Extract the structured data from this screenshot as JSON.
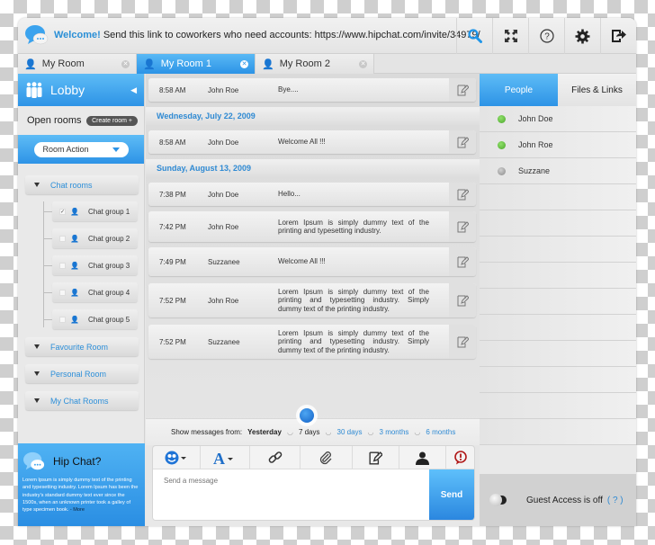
{
  "header": {
    "welcome_bold": "Welcome!",
    "welcome_text": " Send this link to coworkers who need accounts: https://www.hipchat.com/invite/34979/",
    "icons": [
      "search-icon",
      "fullscreen-icon",
      "help-icon",
      "gear-icon",
      "logout-icon"
    ]
  },
  "tabs": [
    {
      "label": "My Room",
      "active": false
    },
    {
      "label": "My Room 1",
      "active": true
    },
    {
      "label": "My Room 2",
      "active": false
    }
  ],
  "sidebar": {
    "lobby_label": "Lobby",
    "open_rooms_label": "Open rooms",
    "create_room_label": "Create room +",
    "room_action_label": "Room Action",
    "sections": {
      "chat_rooms": "Chat rooms",
      "favourite": "Favourite Room",
      "personal": "Personal Room",
      "my_chat_rooms": "My Chat Rooms"
    },
    "chat_groups": [
      {
        "label": "Chat group 1",
        "checked": true
      },
      {
        "label": "Chat group 2",
        "checked": false
      },
      {
        "label": "Chat group 3",
        "checked": false
      },
      {
        "label": "Chat group 4",
        "checked": false
      },
      {
        "label": "Chat group 5",
        "checked": false
      }
    ],
    "promo": {
      "title": "Hip Chat?",
      "text": "Lorem Ipsum is simply dummy text of the printing and typesetting industry. Lorem Ipsum has been the industry's standard dummy text ever since the 1500s, when an unknown printer took a galley of type specimen book. ",
      "more": "- More"
    }
  },
  "chat": {
    "messages": [
      {
        "time": "8:58 AM",
        "user": "John Roe",
        "text": "Bye...."
      },
      {
        "date": "Wednesday, July 22, 2009"
      },
      {
        "time": "8:58 AM",
        "user": "John Doe",
        "text": "Welcome All !!!"
      },
      {
        "date": "Sunday, August 13, 2009"
      },
      {
        "time": "7:38 PM",
        "user": "John Doe",
        "text": "Hello..."
      },
      {
        "time": "7:42 PM",
        "user": "John Roe",
        "text": "Lorem Ipsum is simply dummy text of the printing and typesetting industry."
      },
      {
        "time": "7:49 PM",
        "user": "Suzzanee",
        "text": "Welcome All !!!"
      },
      {
        "time": "7:52 PM",
        "user": "John Roe",
        "text": "Lorem Ipsum is simply dummy text of the printing and typesetting industry. Simply dummy text of the printing industry."
      },
      {
        "time": "7:52 PM",
        "user": "Suzzanee",
        "text": "Lorem Ipsum is simply dummy text of the printing and typesetting industry. Simply dummy text of the printing industry."
      }
    ],
    "filter": {
      "label": "Show messages from:",
      "options": [
        "Yesterday",
        "7 days",
        "30 days",
        "3 months",
        "6 months"
      ],
      "selected": "7 days"
    },
    "composer": {
      "placeholder": "Send a message",
      "send_label": "Send",
      "tools": [
        "emoticon-icon",
        "font-icon",
        "link-icon",
        "attachment-icon",
        "edit-icon",
        "user-icon",
        "alert-icon"
      ]
    }
  },
  "people": {
    "tabs": [
      {
        "label": "People",
        "active": true
      },
      {
        "label": "Files & Links",
        "active": false
      }
    ],
    "list": [
      {
        "name": "John Doe",
        "status": "online",
        "color": "#5cba3c"
      },
      {
        "name": "John Roe",
        "status": "online",
        "color": "#5cba3c"
      },
      {
        "name": "Suzzane",
        "status": "offline",
        "color": "#9a9a9a"
      }
    ],
    "guest_text": "Guest Access is off",
    "guest_help": "( ? )"
  },
  "colors": {
    "accent": "#2d93e6",
    "link": "#2f8ad3",
    "online": "#5cba3c"
  }
}
